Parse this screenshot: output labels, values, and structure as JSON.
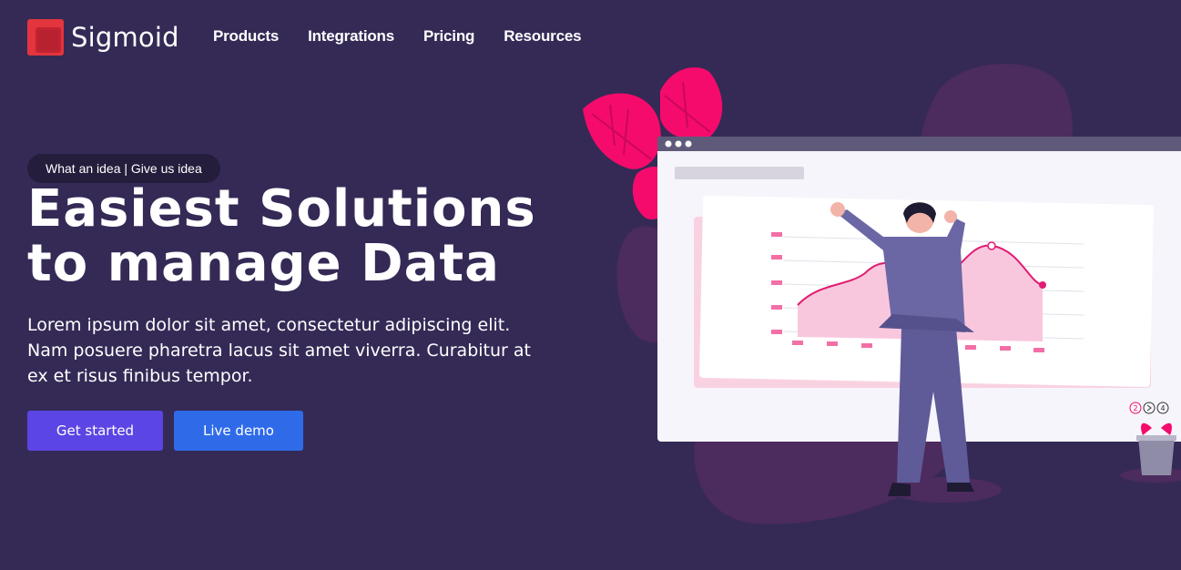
{
  "brand": {
    "name": "Sigmoid"
  },
  "nav": {
    "items": [
      {
        "label": "Products"
      },
      {
        "label": "Integrations"
      },
      {
        "label": "Pricing"
      },
      {
        "label": "Resources"
      }
    ]
  },
  "hero": {
    "badge": "What an idea | Give us idea",
    "title_line1": "Easiest Solutions",
    "title_line2": "to manage Data",
    "text": "Lorem ipsum dolor sit amet, consectetur adipiscing elit. Nam posuere pharetra lacus sit amet viverra. Curabitur at ex et risus finibus tempor.",
    "primary_cta": "Get started",
    "secondary_cta": "Live demo"
  },
  "colors": {
    "background": "#352a56",
    "accent_pink": "#f50b6c",
    "button_primary": "#5b45e4",
    "button_secondary": "#2f6be9",
    "logo_red": "#e2353d"
  },
  "illustration": {
    "pager": [
      "2",
      "4"
    ]
  }
}
